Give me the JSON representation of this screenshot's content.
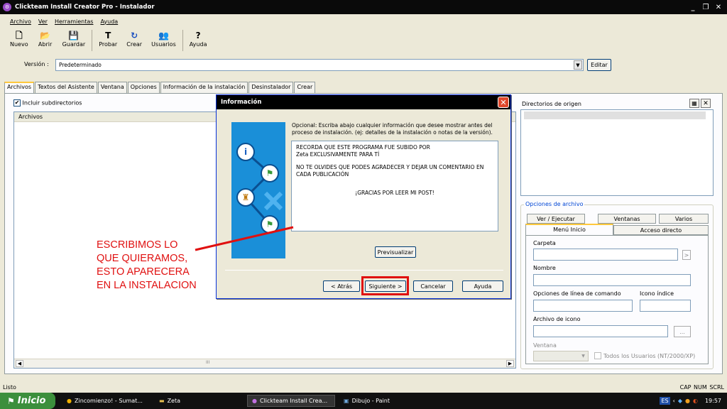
{
  "window": {
    "title": "Clickteam Install Creator Pro - Instalador"
  },
  "menu": [
    "Archivo",
    "Ver",
    "Herramientas",
    "Ayuda"
  ],
  "toolbar": [
    {
      "label": "Nuevo",
      "icon": "new-file-icon"
    },
    {
      "label": "Abrir",
      "icon": "open-folder-icon"
    },
    {
      "label": "Guardar",
      "icon": "save-icon"
    },
    {
      "label": "Probar",
      "icon": "test-icon"
    },
    {
      "label": "Crear",
      "icon": "build-icon"
    },
    {
      "label": "Usuarios",
      "icon": "users-icon"
    },
    {
      "label": "Ayuda",
      "icon": "help-icon"
    }
  ],
  "version": {
    "label": "Versión :",
    "value": "Predeterminado",
    "edit": "Editar"
  },
  "tabs": [
    "Archivos",
    "Textos del Asistente",
    "Ventana",
    "Opciones",
    "Información de la instalación",
    "Desinstalador",
    "Crear"
  ],
  "files": {
    "include_subdirs": "Incluir subdirectorios",
    "column": "Archivos",
    "scroll_mark": "III"
  },
  "source_dirs": {
    "label": "Directorios de origen"
  },
  "file_options": {
    "legend": "Opciones de archivo",
    "tabs_row1": [
      "Ver / Ejecutar",
      "Ventanas",
      "Varios"
    ],
    "tabs_row2": [
      "Menú Inicio",
      "Acceso directo"
    ],
    "carpeta": "Carpeta",
    "nombre": "Nombre",
    "cmdline": "Opciones de línea de comando",
    "icon_index": "Icono índice",
    "icon_file": "Archivo de icono",
    "browse": "...",
    "arrow": ">",
    "ventana": "Ventana",
    "all_users": "Todos los Usuarios (NT/2000/XP)"
  },
  "dialog": {
    "title": "Información",
    "description": "Opcional: Escriba abajo cualquier información que desee mostrar antes del proceso de instalación. (ej: detalles de la instalación o notas de la versión).",
    "text_lines": [
      "RECORDA QUE ESTE PROGRAMA FUE SUBIDO POR",
      "Zeta EXCLUSIVAMENTE PARA TÍ",
      "",
      "NO TE OLVIDES QUE PODES AGRADECER Y DEJAR UN COMENTARIO EN",
      "CADA PUBLICACIÓN"
    ],
    "center_line": "¡GRACIAS POR LEER MI POST!",
    "preview": "Previsualizar",
    "back": "< Atrás",
    "next": "Siguiente >",
    "cancel": "Cancelar",
    "help": "Ayuda"
  },
  "annotation": [
    "ESCRIBIMOS LO",
    "QUE QUIERAMOS,",
    "ESTO APARECERA",
    "EN LA INSTALACION"
  ],
  "status": {
    "left": "Listo",
    "right": "CAP  NUM  SCRL"
  },
  "taskbar": {
    "start": "Inicio",
    "tasks": [
      "Zincomienzo! - Sumat...",
      "Zeta",
      "Clickteam Install Crea...",
      "Dibujo - Paint"
    ],
    "lang": "ES",
    "clock": "19:57"
  },
  "colors": {
    "annotation": "#e01010",
    "accent_title": "#000000",
    "banner": "#1a8fd8"
  }
}
